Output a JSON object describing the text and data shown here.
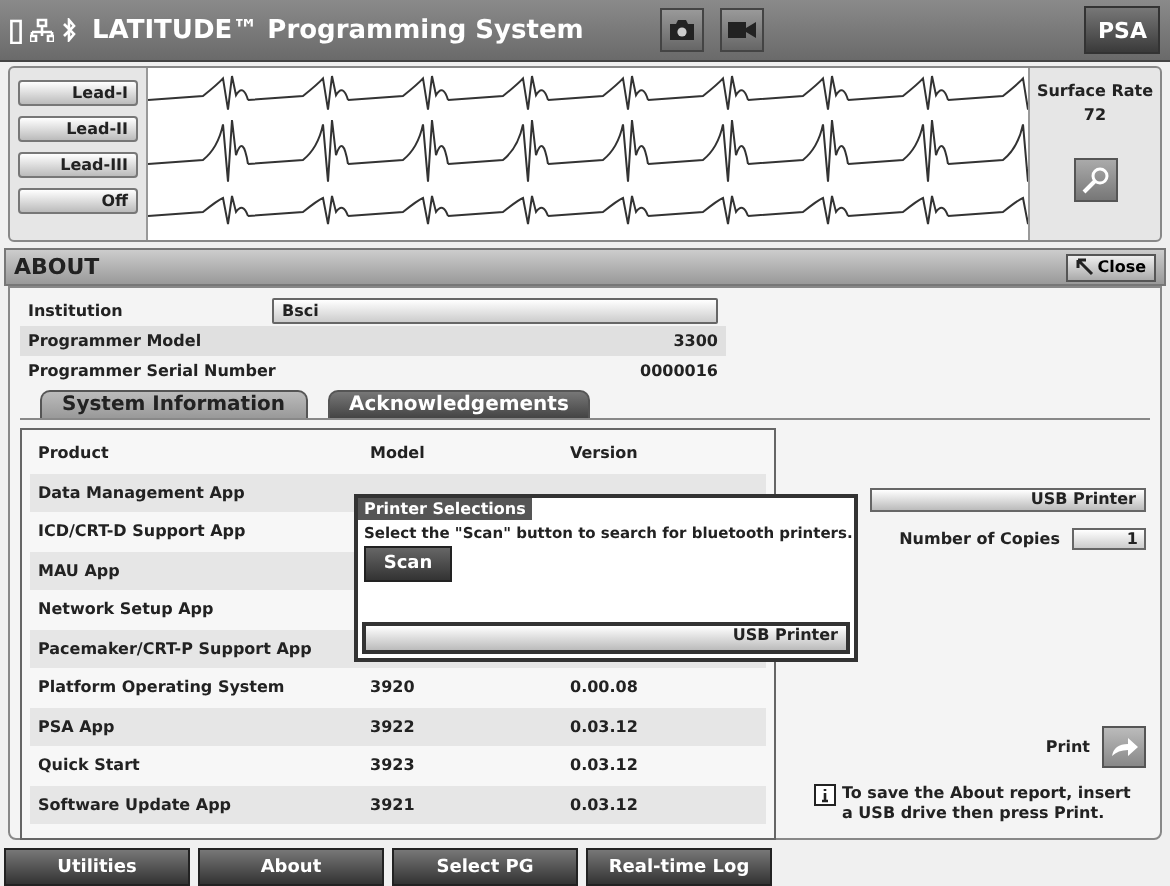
{
  "header": {
    "title": "LATITUDE™ Programming System",
    "psa_button": "PSA"
  },
  "leads": [
    "Lead-I",
    "Lead-II",
    "Lead-III",
    "Off"
  ],
  "surface_rate": {
    "label": "Surface Rate",
    "value": "72"
  },
  "about": {
    "title": "ABOUT",
    "close": "Close"
  },
  "info": [
    {
      "label": "Institution",
      "value": "Bsci",
      "kind": "field"
    },
    {
      "label": "Programmer Model",
      "value": "3300",
      "kind": "text"
    },
    {
      "label": "Programmer Serial Number",
      "value": "0000016",
      "kind": "text"
    }
  ],
  "tabs": [
    {
      "label": "System Information",
      "selected": true
    },
    {
      "label": "Acknowledgements",
      "selected": false
    }
  ],
  "table": {
    "columns": [
      "Product",
      "Model",
      "Version"
    ],
    "rows": [
      {
        "product": "Data Management App"
      },
      {
        "product": "ICD/CRT-D Support App"
      },
      {
        "product": "MAU App"
      },
      {
        "product": "Network Setup App"
      },
      {
        "product": "Pacemaker/CRT-P Support App"
      },
      {
        "product": "Platform Operating System",
        "model": "3920",
        "version": "0.00.08"
      },
      {
        "product": "PSA App",
        "model": "3922",
        "version": "0.03.12"
      },
      {
        "product": "Quick Start",
        "model": "3923",
        "version": "0.03.12"
      },
      {
        "product": "Software Update App",
        "model": "3921",
        "version": "0.03.12"
      }
    ]
  },
  "printer": {
    "selection": "USB Printer",
    "copies_label": "Number of Copies",
    "copies": "1",
    "print_label": "Print",
    "note": "To save the About report, insert a USB drive then press Print."
  },
  "popup": {
    "title": "Printer Selections",
    "message": "Select the \"Scan\" button to search for bluetooth printers.",
    "scan": "Scan",
    "printer": "USB Printer"
  },
  "nav": [
    "Utilities",
    "About",
    "Select PG",
    "Real-time Log"
  ]
}
